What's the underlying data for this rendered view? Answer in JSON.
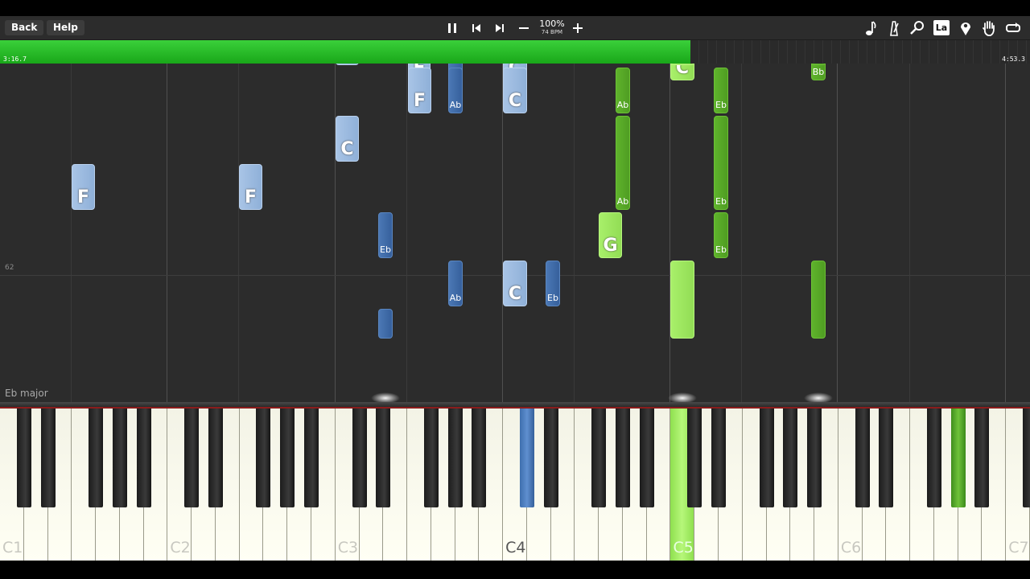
{
  "toolbar": {
    "back_label": "Back",
    "help_label": "Help",
    "zoom_percent": "100%",
    "tempo": "74 BPM",
    "icons": [
      "pause-icon",
      "skip-back-icon",
      "skip-forward-icon",
      "zoom-out-icon",
      "zoom-in-icon",
      "note-icon",
      "metronome-icon",
      "search-icon",
      "la-icon",
      "location-pin-icon",
      "hand-icon",
      "loop-icon"
    ],
    "la_label": "La"
  },
  "progress": {
    "elapsed": "3:16.7",
    "total": "4:53.3",
    "fraction": 0.67,
    "color": "#22c122"
  },
  "roll": {
    "row_label": "62",
    "key_label": "Eb major",
    "notes": [
      {
        "label": "F",
        "style": "lightblue",
        "size": "big"
      },
      {
        "label": "Ab",
        "style": "darkblue",
        "size": "small"
      },
      {
        "label": "C",
        "style": "lightblue",
        "size": "big"
      },
      {
        "label": "C",
        "style": "lightgreen",
        "size": "big"
      },
      {
        "label": "Bb",
        "style": "darkgreen",
        "size": "small"
      },
      {
        "label": "C",
        "style": "lightblue",
        "size": "big"
      },
      {
        "label": "C",
        "style": "lightgreen",
        "size": "big"
      },
      {
        "label": "Bb",
        "style": "darkgreen",
        "size": "small"
      },
      {
        "label": "F",
        "style": "lightblue",
        "size": "big"
      },
      {
        "label": "Ab",
        "style": "darkblue",
        "size": "small"
      },
      {
        "label": "C",
        "style": "lightblue",
        "size": "big"
      },
      {
        "label": "Ab",
        "style": "darkgreen",
        "size": "small"
      },
      {
        "label": "Eb",
        "style": "darkgreen",
        "size": "small"
      },
      {
        "label": "C",
        "style": "lightblue",
        "size": "big"
      },
      {
        "label": "Ab",
        "style": "darkgreen",
        "size": "small"
      },
      {
        "label": "Eb",
        "style": "darkgreen",
        "size": "small"
      },
      {
        "label": "F",
        "style": "lightblue",
        "size": "big"
      },
      {
        "label": "F",
        "style": "lightblue",
        "size": "big"
      },
      {
        "label": "Eb",
        "style": "darkblue",
        "size": "small"
      },
      {
        "label": "G",
        "style": "lightgreen",
        "size": "big"
      },
      {
        "label": "Eb",
        "style": "darkgreen",
        "size": "small"
      },
      {
        "label": "Ab",
        "style": "darkblue",
        "size": "small"
      },
      {
        "label": "C",
        "style": "lightblue",
        "size": "big"
      },
      {
        "label": "Eb",
        "style": "darkblue",
        "size": "small"
      },
      {
        "label": "",
        "style": "lightgreen",
        "size": "big"
      },
      {
        "label": "",
        "style": "darkgreen",
        "size": "small"
      },
      {
        "label": "",
        "style": "darkblue",
        "size": "small"
      }
    ]
  },
  "keyboard": {
    "octave_labels": [
      "C1",
      "C2",
      "C3",
      "C4",
      "C5",
      "C6",
      "C7"
    ]
  }
}
